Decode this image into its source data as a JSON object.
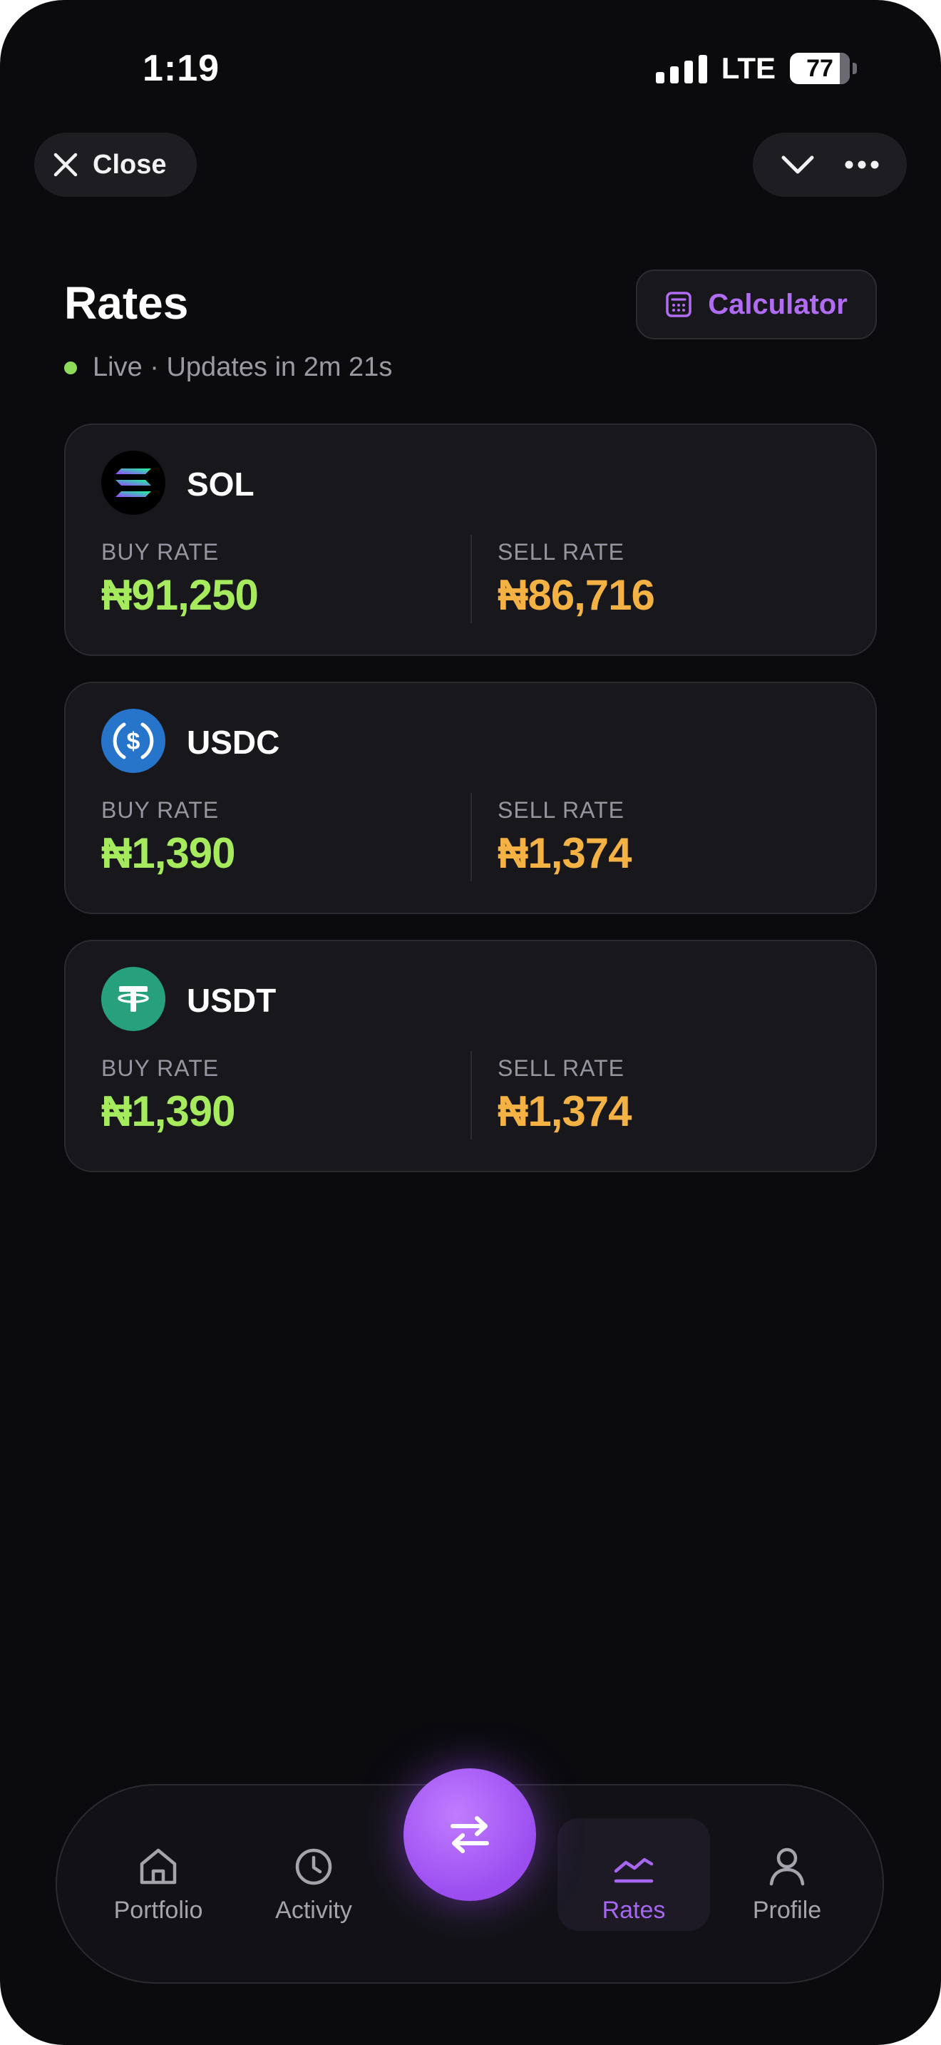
{
  "status_bar": {
    "time": "1:19",
    "network": "LTE",
    "battery": "77"
  },
  "top_bar": {
    "close_label": "Close"
  },
  "header": {
    "title": "Rates",
    "live_status": "Live · Updates in 2m 21s",
    "calculator_label": "Calculator"
  },
  "rates": [
    {
      "coin": "SOL",
      "icon": "solana-logo-icon",
      "buy_label": "BUY RATE",
      "buy_value": "₦91,250",
      "sell_label": "SELL RATE",
      "sell_value": "₦86,716"
    },
    {
      "coin": "USDC",
      "icon": "usdc-logo-icon",
      "buy_label": "BUY RATE",
      "buy_value": "₦1,390",
      "sell_label": "SELL RATE",
      "sell_value": "₦1,374"
    },
    {
      "coin": "USDT",
      "icon": "tether-logo-icon",
      "buy_label": "BUY RATE",
      "buy_value": "₦1,390",
      "sell_label": "SELL RATE",
      "sell_value": "₦1,374"
    }
  ],
  "nav": {
    "items": [
      {
        "label": "Portfolio",
        "icon": "home-icon"
      },
      {
        "label": "Activity",
        "icon": "clock-icon"
      },
      {
        "label": "Rates",
        "icon": "chart-line-icon",
        "active": true
      },
      {
        "label": "Profile",
        "icon": "user-icon"
      }
    ],
    "center_action_icon": "swap-arrows-icon"
  },
  "colors": {
    "background": "#0b0b0e",
    "card": "#17171c",
    "accent": "#a766f0",
    "buy": "#a6ea5e",
    "sell": "#f5b244",
    "live_dot": "#8fdc5a"
  }
}
